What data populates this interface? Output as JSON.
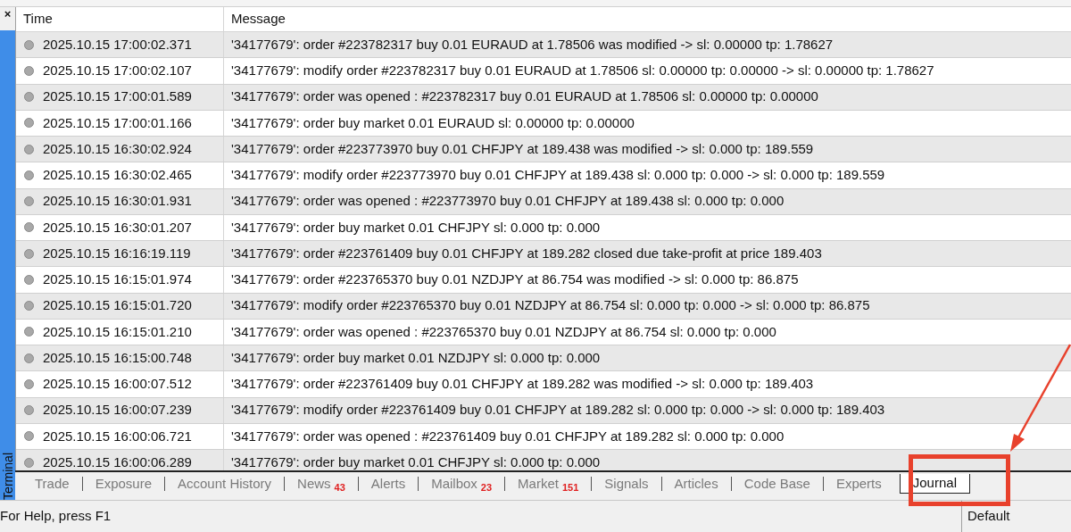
{
  "panel": {
    "close": "×",
    "title": "Terminal"
  },
  "table": {
    "columns": [
      "Time",
      "Message"
    ],
    "rows": [
      {
        "time": "2025.10.15 17:00:02.371",
        "message": "'34177679': order #223782317 buy 0.01 EURAUD at 1.78506 was modified -> sl: 0.00000 tp: 1.78627"
      },
      {
        "time": "2025.10.15 17:00:02.107",
        "message": "'34177679': modify order #223782317 buy 0.01 EURAUD at 1.78506 sl: 0.00000 tp: 0.00000 -> sl: 0.00000 tp: 1.78627"
      },
      {
        "time": "2025.10.15 17:00:01.589",
        "message": "'34177679': order was opened : #223782317 buy 0.01 EURAUD at 1.78506 sl: 0.00000 tp: 0.00000"
      },
      {
        "time": "2025.10.15 17:00:01.166",
        "message": "'34177679': order buy market 0.01 EURAUD sl: 0.00000 tp: 0.00000"
      },
      {
        "time": "2025.10.15 16:30:02.924",
        "message": "'34177679': order #223773970 buy 0.01 CHFJPY at 189.438 was modified -> sl: 0.000 tp: 189.559"
      },
      {
        "time": "2025.10.15 16:30:02.465",
        "message": "'34177679': modify order #223773970 buy 0.01 CHFJPY at 189.438 sl: 0.000 tp: 0.000 -> sl: 0.000 tp: 189.559"
      },
      {
        "time": "2025.10.15 16:30:01.931",
        "message": "'34177679': order was opened : #223773970 buy 0.01 CHFJPY at 189.438 sl: 0.000 tp: 0.000"
      },
      {
        "time": "2025.10.15 16:30:01.207",
        "message": "'34177679': order buy market 0.01 CHFJPY sl: 0.000 tp: 0.000"
      },
      {
        "time": "2025.10.15 16:16:19.119",
        "message": "'34177679': order #223761409 buy 0.01 CHFJPY at 189.282 closed due take-profit at price 189.403"
      },
      {
        "time": "2025.10.15 16:15:01.974",
        "message": "'34177679': order #223765370 buy 0.01 NZDJPY at 86.754 was modified -> sl: 0.000 tp: 86.875"
      },
      {
        "time": "2025.10.15 16:15:01.720",
        "message": "'34177679': modify order #223765370 buy 0.01 NZDJPY at 86.754 sl: 0.000 tp: 0.000 -> sl: 0.000 tp: 86.875"
      },
      {
        "time": "2025.10.15 16:15:01.210",
        "message": "'34177679': order was opened : #223765370 buy 0.01 NZDJPY at 86.754 sl: 0.000 tp: 0.000"
      },
      {
        "time": "2025.10.15 16:15:00.748",
        "message": "'34177679': order buy market 0.01 NZDJPY sl: 0.000 tp: 0.000"
      },
      {
        "time": "2025.10.15 16:00:07.512",
        "message": "'34177679': order #223761409 buy 0.01 CHFJPY at 189.282 was modified -> sl: 0.000 tp: 189.403"
      },
      {
        "time": "2025.10.15 16:00:07.239",
        "message": "'34177679': modify order #223761409 buy 0.01 CHFJPY at 189.282 sl: 0.000 tp: 0.000 -> sl: 0.000 tp: 189.403"
      },
      {
        "time": "2025.10.15 16:00:06.721",
        "message": "'34177679': order was opened : #223761409 buy 0.01 CHFJPY at 189.282 sl: 0.000 tp: 0.000"
      },
      {
        "time": "2025.10.15 16:00:06.289",
        "message": "'34177679': order buy market 0.01 CHFJPY sl: 0.000 tp: 0.000"
      }
    ]
  },
  "tabs": [
    {
      "label": "Trade",
      "selected": false
    },
    {
      "label": "Exposure",
      "selected": false
    },
    {
      "label": "Account History",
      "selected": false
    },
    {
      "label": "News",
      "badge": "43",
      "selected": false
    },
    {
      "label": "Alerts",
      "selected": false
    },
    {
      "label": "Mailbox",
      "badge": "23",
      "selected": false
    },
    {
      "label": "Market",
      "badge": "151",
      "selected": false
    },
    {
      "label": "Signals",
      "selected": false
    },
    {
      "label": "Articles",
      "selected": false
    },
    {
      "label": "Code Base",
      "selected": false
    },
    {
      "label": "Experts",
      "selected": false
    },
    {
      "label": "Journal",
      "selected": true
    }
  ],
  "status_bar": {
    "help": "For Help, press F1",
    "profile": "Default"
  }
}
